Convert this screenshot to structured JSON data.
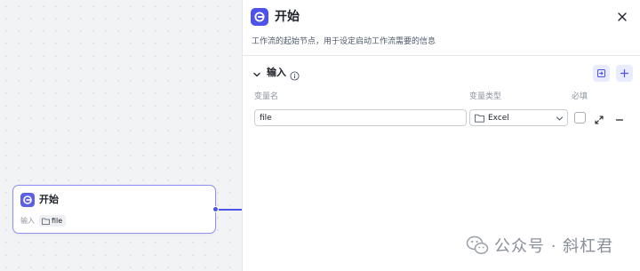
{
  "node": {
    "title": "开始",
    "input_label": "输入",
    "input_chip": "file"
  },
  "panel": {
    "title": "开始",
    "description": "工作流的起始节点，用于设定启动工作流需要的信息",
    "section": {
      "title": "输入",
      "columns": {
        "name": "变量名",
        "type": "变量类型",
        "required": "必填"
      },
      "rows": [
        {
          "name": "file",
          "type": "Excel",
          "required": false
        }
      ]
    }
  },
  "watermark": {
    "text": "公众号 · 斜杠君"
  },
  "colors": {
    "accent": "#4d53e8",
    "node_border": "#8c8ff5",
    "icon_button_bg": "#e9ebff"
  },
  "icons": {
    "start": "start-icon",
    "close": "close-icon",
    "collapse": "chevron-down-icon",
    "info": "info-icon",
    "import": "import-icon",
    "add": "plus-icon",
    "folder": "folder-icon",
    "expand": "expand-icon",
    "remove": "minus-icon",
    "watermark": "wechat-icon"
  }
}
